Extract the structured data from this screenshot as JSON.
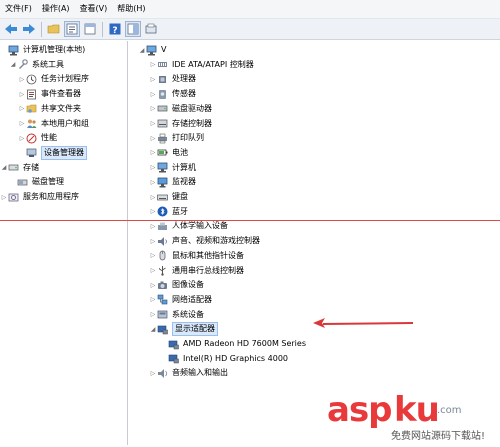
{
  "menu": [
    "文件(F)",
    "操作(A)",
    "查看(V)",
    "帮助(H)"
  ],
  "toolbar": {
    "icons": [
      "back-icon",
      "forward-icon",
      "folder-icon",
      "properties-icon",
      "pane-icon",
      "help-icon",
      "panel-icon",
      "scan-icon"
    ]
  },
  "left_tree": [
    {
      "label": "计算机管理(本地)",
      "icon": "computer-icon",
      "indent": 0,
      "twisty": ""
    },
    {
      "label": "系统工具",
      "icon": "tools-icon",
      "indent": 1,
      "twisty": "◢"
    },
    {
      "label": "任务计划程序",
      "icon": "clock-icon",
      "indent": 2,
      "twisty": "▷"
    },
    {
      "label": "事件查看器",
      "icon": "event-icon",
      "indent": 2,
      "twisty": "▷"
    },
    {
      "label": "共享文件夹",
      "icon": "shared-folder-icon",
      "indent": 2,
      "twisty": "▷"
    },
    {
      "label": "本地用户和组",
      "icon": "users-icon",
      "indent": 2,
      "twisty": "▷"
    },
    {
      "label": "性能",
      "icon": "performance-icon",
      "indent": 2,
      "twisty": "▷"
    },
    {
      "label": "设备管理器",
      "icon": "device-manager-icon",
      "indent": 2,
      "twisty": "",
      "selected": true
    },
    {
      "label": "存储",
      "icon": "storage-icon",
      "indent": 0,
      "twisty": "◢"
    },
    {
      "label": "磁盘管理",
      "icon": "disk-icon",
      "indent": 1,
      "twisty": ""
    },
    {
      "label": "服务和应用程序",
      "icon": "services-icon",
      "indent": 0,
      "twisty": "▷"
    }
  ],
  "right_tree": [
    {
      "label": "V",
      "icon": "computer-icon",
      "indent": 0,
      "twisty": "◢"
    },
    {
      "label": "IDE ATA/ATAPI 控制器",
      "icon": "ide-controller-icon",
      "indent": 1,
      "twisty": "▷"
    },
    {
      "label": "处理器",
      "icon": "processor-icon",
      "indent": 1,
      "twisty": "▷"
    },
    {
      "label": "传感器",
      "icon": "sensor-icon",
      "indent": 1,
      "twisty": "▷"
    },
    {
      "label": "磁盘驱动器",
      "icon": "disk-drive-icon",
      "indent": 1,
      "twisty": "▷"
    },
    {
      "label": "存储控制器",
      "icon": "storage-controller-icon",
      "indent": 1,
      "twisty": "▷"
    },
    {
      "label": "打印队列",
      "icon": "printer-icon",
      "indent": 1,
      "twisty": "▷"
    },
    {
      "label": "电池",
      "icon": "battery-icon",
      "indent": 1,
      "twisty": "▷"
    },
    {
      "label": "计算机",
      "icon": "computer-icon",
      "indent": 1,
      "twisty": "▷"
    },
    {
      "label": "监视器",
      "icon": "monitor-icon",
      "indent": 1,
      "twisty": "▷"
    },
    {
      "label": "键盘",
      "icon": "keyboard-icon",
      "indent": 1,
      "twisty": "▷"
    },
    {
      "label": "蓝牙",
      "icon": "bluetooth-icon",
      "indent": 1,
      "twisty": "▷"
    },
    {
      "label": "人体学输入设备",
      "icon": "hid-icon",
      "indent": 1,
      "twisty": "▷"
    },
    {
      "label": "声音、视频和游戏控制器",
      "icon": "sound-icon",
      "indent": 1,
      "twisty": "▷"
    },
    {
      "label": "鼠标和其他指针设备",
      "icon": "mouse-icon",
      "indent": 1,
      "twisty": "▷"
    },
    {
      "label": "通用串行总线控制器",
      "icon": "usb-icon",
      "indent": 1,
      "twisty": "▷"
    },
    {
      "label": "图像设备",
      "icon": "camera-icon",
      "indent": 1,
      "twisty": "▷"
    },
    {
      "label": "网络适配器",
      "icon": "network-icon",
      "indent": 1,
      "twisty": "▷"
    },
    {
      "label": "系统设备",
      "icon": "system-device-icon",
      "indent": 1,
      "twisty": "▷"
    },
    {
      "label": "显示适配器",
      "icon": "display-adapter-icon",
      "indent": 1,
      "twisty": "◢",
      "selected": true
    },
    {
      "label": "AMD Radeon HD 7600M Series",
      "icon": "display-adapter-icon",
      "indent": 2,
      "twisty": ""
    },
    {
      "label": "Intel(R) HD Graphics 4000",
      "icon": "display-adapter-icon",
      "indent": 2,
      "twisty": ""
    },
    {
      "label": "音频输入和输出",
      "icon": "audio-icon",
      "indent": 1,
      "twisty": "▷"
    }
  ],
  "colors": {
    "annotation": "#d9383a",
    "selection": "#d9e8fb",
    "watermark": "#e83a3a"
  },
  "watermark": {
    "logo": "aspku",
    "tld": ".com",
    "slogan": "免费网站源码下载站!"
  }
}
